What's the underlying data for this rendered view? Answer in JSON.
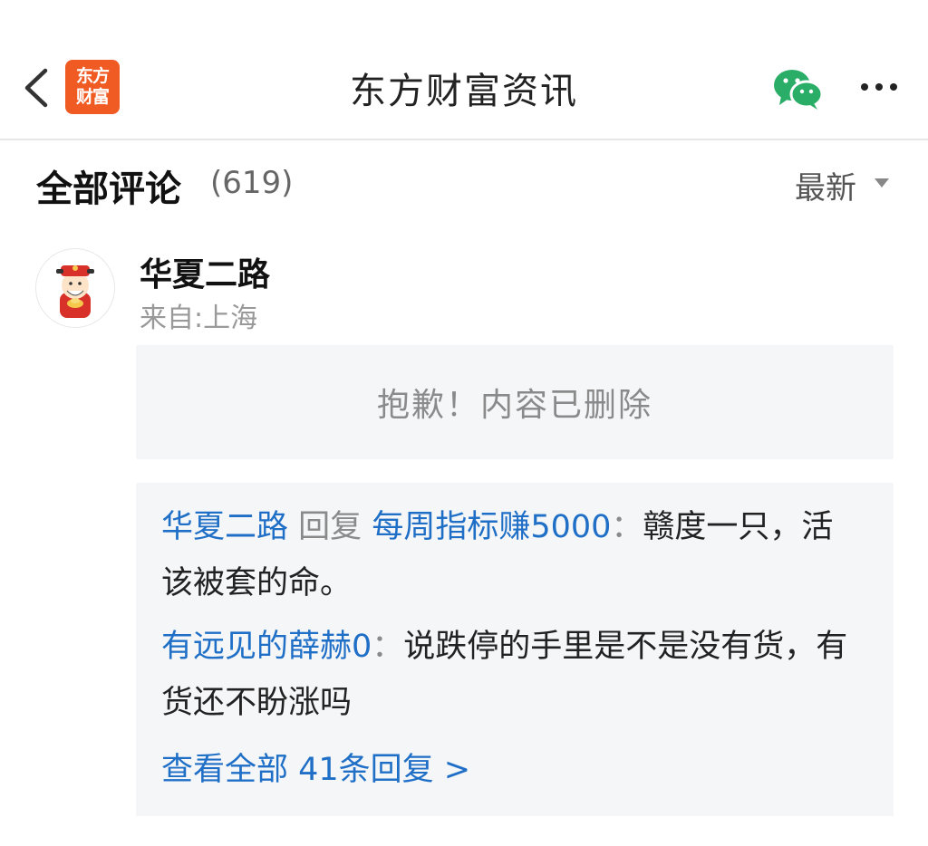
{
  "header": {
    "title": "东方财富资讯",
    "logo_line1": "东方",
    "logo_line2": "财富",
    "brand_color": "#f05a23",
    "icons": [
      "back-chevron-icon",
      "wechat-icon",
      "more-icon"
    ]
  },
  "comments": {
    "section_title": "全部评论",
    "count": "(619)",
    "sort_label": "最新"
  },
  "comment": {
    "username": "华夏二路",
    "location": "来自:上海",
    "deleted_text": "抱歉！内容已删除",
    "replies": [
      {
        "author": "华夏二路",
        "reply_word": "回复",
        "target": "每周指标赚5000",
        "separator": "：",
        "text": "赣度一只，活该被套的命。"
      },
      {
        "author": "有远见的薛赫0",
        "separator": "：",
        "text": "说跌停的手里是不是没有货，有货还不盼涨吗"
      }
    ],
    "view_all_label": "查看全部 41条回复 >"
  },
  "colors": {
    "link_blue": "#1f6fc7",
    "panel_bg": "#f4f6f8"
  }
}
